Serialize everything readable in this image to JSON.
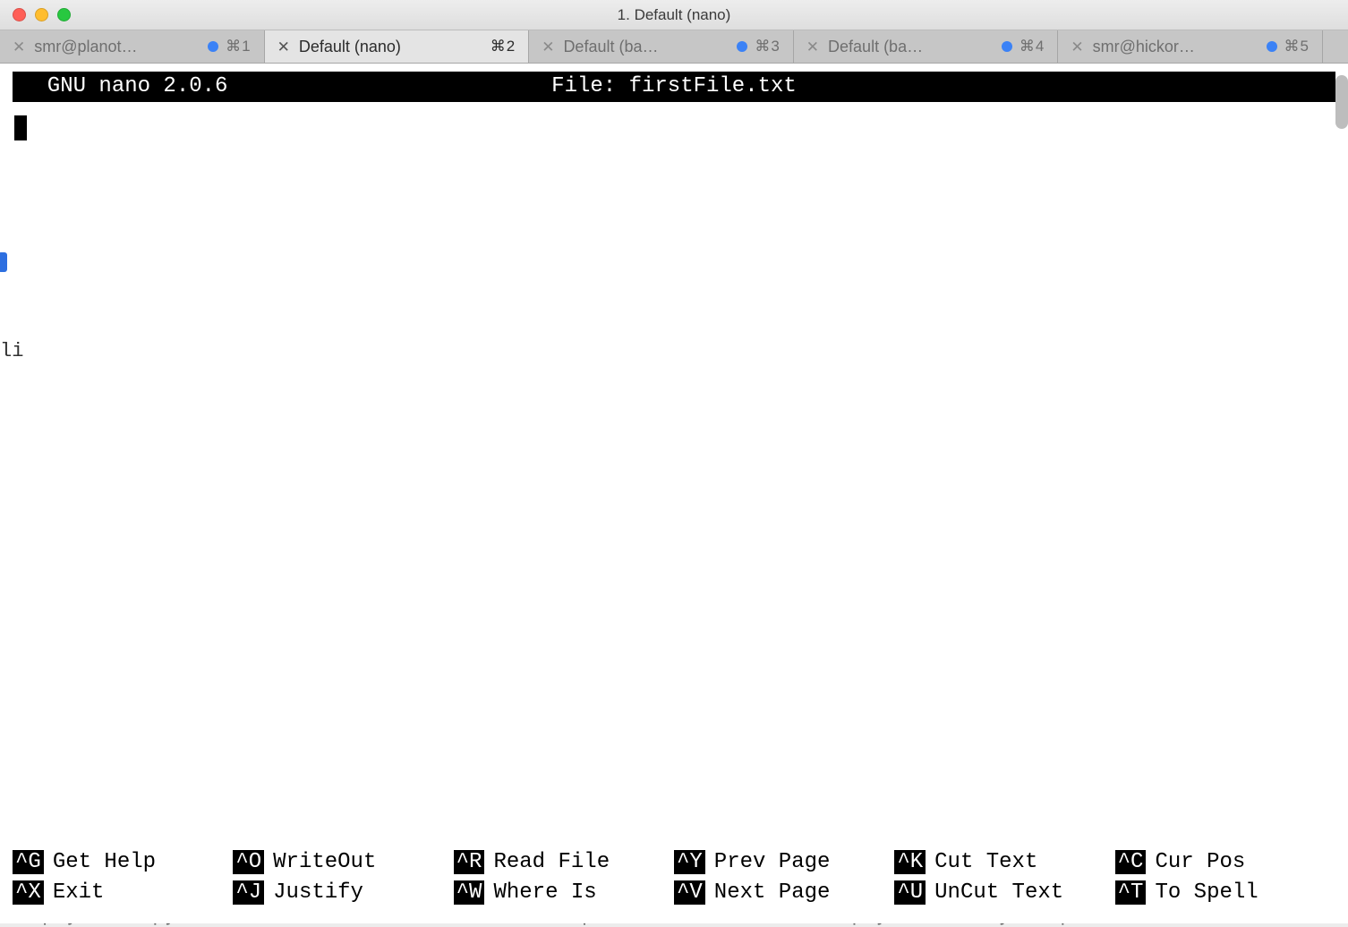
{
  "window": {
    "title": "1. Default (nano)"
  },
  "tabs": [
    {
      "label": "smr@planot…",
      "hasDot": true,
      "shortcut": "⌘1",
      "active": false
    },
    {
      "label": "Default (nano)",
      "hasDot": false,
      "shortcut": "⌘2",
      "active": true
    },
    {
      "label": "Default (ba…",
      "hasDot": true,
      "shortcut": "⌘3",
      "active": false
    },
    {
      "label": "Default (ba…",
      "hasDot": true,
      "shortcut": "⌘4",
      "active": false
    },
    {
      "label": "smr@hickor…",
      "hasDot": true,
      "shortcut": "⌘5",
      "active": false
    }
  ],
  "nano": {
    "app": "  GNU nano 2.0.6",
    "fileLabel": "File: firstFile.txt",
    "shortcuts": [
      {
        "key": "^G",
        "label": "Get Help"
      },
      {
        "key": "^O",
        "label": "WriteOut"
      },
      {
        "key": "^R",
        "label": "Read File"
      },
      {
        "key": "^Y",
        "label": "Prev Page"
      },
      {
        "key": "^K",
        "label": "Cut Text"
      },
      {
        "key": "^C",
        "label": "Cur Pos"
      },
      {
        "key": "^X",
        "label": "Exit"
      },
      {
        "key": "^J",
        "label": "Justify"
      },
      {
        "key": "^W",
        "label": "Where Is"
      },
      {
        "key": "^V",
        "label": "Next Page"
      },
      {
        "key": "^U",
        "label": "UnCut Text"
      },
      {
        "key": "^T",
        "label": "To Spell"
      }
    ]
  },
  "background": {
    "bottomLine": "Keep your copy of the lecture notes and files up to date. Git can help you do very complex task with files. We",
    "leftFrag": "li"
  }
}
